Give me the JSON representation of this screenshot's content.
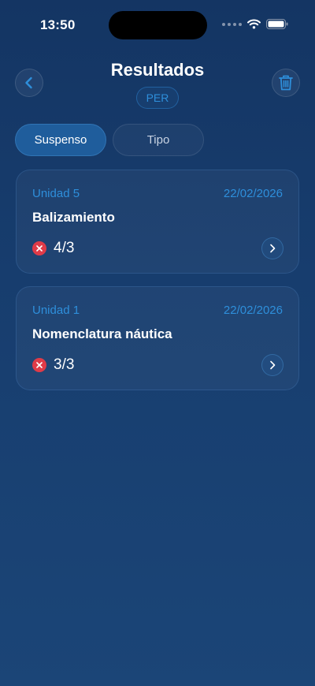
{
  "status_bar": {
    "time": "13:50"
  },
  "header": {
    "title": "Resultados",
    "badge": "PER",
    "back_icon": "chevron-left-icon",
    "trash_icon": "trash-icon"
  },
  "tabs": [
    {
      "label": "Suspenso",
      "active": true
    },
    {
      "label": "Tipo",
      "active": false
    }
  ],
  "results": [
    {
      "unit": "Unidad 5",
      "date": "22/02/2026",
      "title": "Balizamiento",
      "score": "4/3",
      "status_icon": "fail-x-icon"
    },
    {
      "unit": "Unidad 1",
      "date": "22/02/2026",
      "title": "Nomenclatura náutica",
      "score": "3/3",
      "status_icon": "fail-x-icon"
    }
  ],
  "colors": {
    "accent": "#2e8fdb",
    "fail": "#e03b48",
    "tab_active": "#1f5d9c"
  }
}
